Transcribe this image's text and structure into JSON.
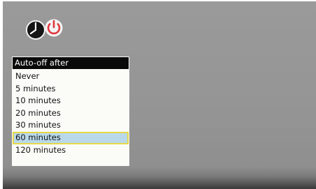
{
  "menu": {
    "title": "Auto-off after",
    "items": [
      {
        "label": "Never",
        "selected": false
      },
      {
        "label": "5 minutes",
        "selected": false
      },
      {
        "label": "10 minutes",
        "selected": false
      },
      {
        "label": "20 minutes",
        "selected": false
      },
      {
        "label": "30 minutes",
        "selected": false
      },
      {
        "label": "60 minutes",
        "selected": true
      },
      {
        "label": "120 minutes",
        "selected": false
      }
    ]
  },
  "icons": {
    "header_icon": "timer-power-off-icon"
  },
  "colors": {
    "selection_fill": "#b9d9ea",
    "selection_border": "#e6d84a",
    "header_bg": "#0a0a0a",
    "power_icon": "#e0373d"
  }
}
